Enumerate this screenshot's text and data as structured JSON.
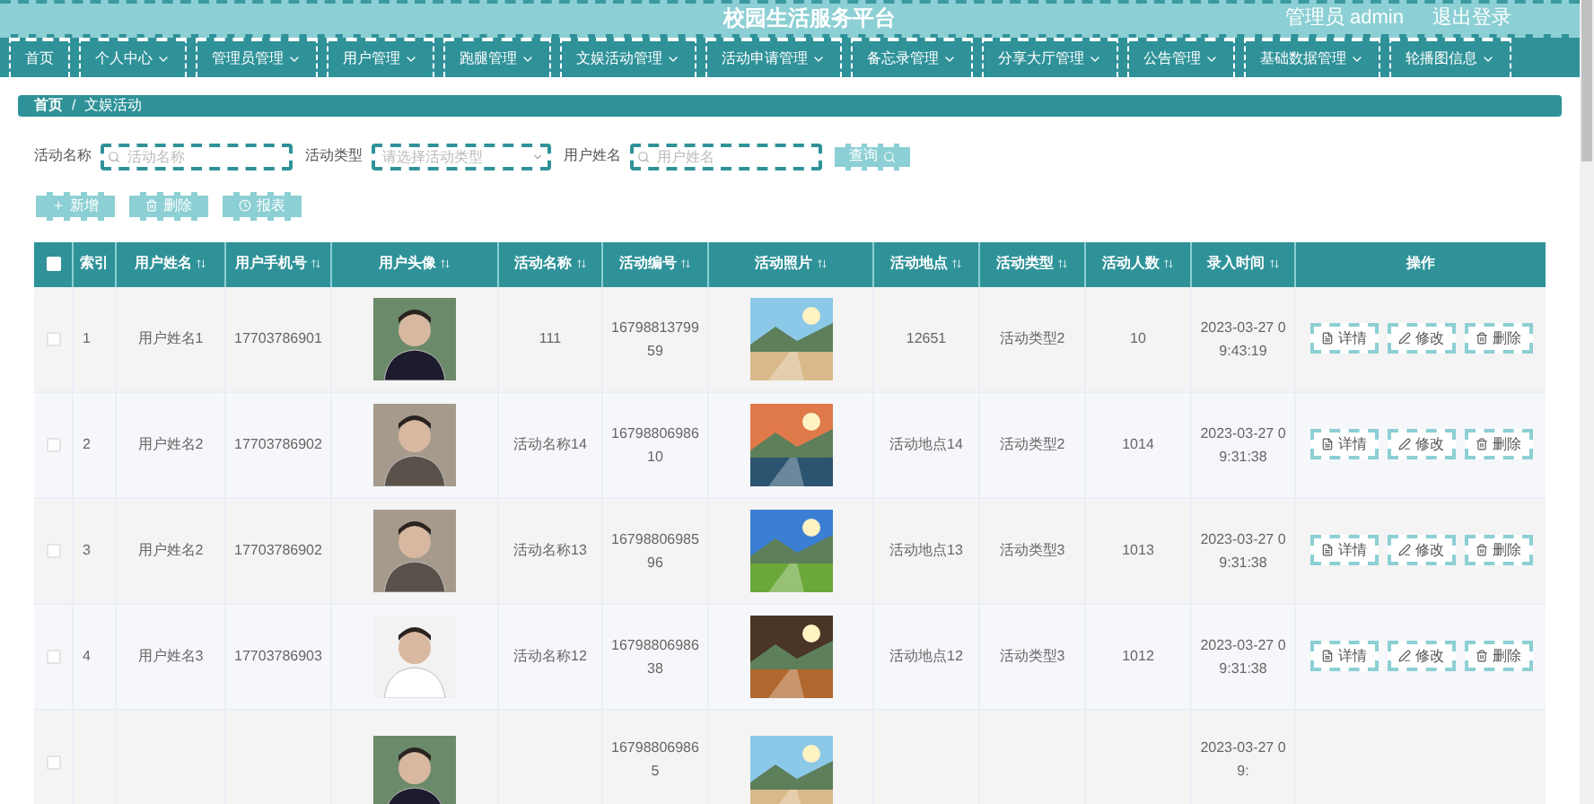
{
  "header": {
    "title": "校园生活服务平台",
    "user": "管理员 admin",
    "logout": "退出登录"
  },
  "nav": [
    {
      "label": "首页",
      "dropdown": false
    },
    {
      "label": "个人中心",
      "dropdown": true
    },
    {
      "label": "管理员管理",
      "dropdown": true
    },
    {
      "label": "用户管理",
      "dropdown": true
    },
    {
      "label": "跑腿管理",
      "dropdown": true
    },
    {
      "label": "文娱活动管理",
      "dropdown": true
    },
    {
      "label": "活动申请管理",
      "dropdown": true
    },
    {
      "label": "备忘录管理",
      "dropdown": true
    },
    {
      "label": "分享大厅管理",
      "dropdown": true
    },
    {
      "label": "公告管理",
      "dropdown": true
    },
    {
      "label": "基础数据管理",
      "dropdown": true
    },
    {
      "label": "轮播图信息",
      "dropdown": true
    }
  ],
  "breadcrumb": [
    "首页",
    "/",
    "文娱活动"
  ],
  "filters": [
    {
      "kind": "search",
      "label": "活动名称",
      "placeholder": "活动名称"
    },
    {
      "kind": "select",
      "label": "活动类型",
      "placeholder": "请选择活动类型"
    },
    {
      "kind": "search",
      "label": "用户姓名",
      "placeholder": "用户姓名"
    }
  ],
  "query_button": "查询",
  "actions": [
    {
      "kind": "add",
      "label": "新增"
    },
    {
      "kind": "delete",
      "label": "删除"
    },
    {
      "kind": "report",
      "label": "报表"
    }
  ],
  "table": {
    "select_all": false,
    "columns": [
      {
        "label": "索引",
        "sortable": false
      },
      {
        "label": "用户姓名",
        "sortable": true
      },
      {
        "label": "用户手机号",
        "sortable": true
      },
      {
        "label": "用户头像",
        "sortable": true
      },
      {
        "label": "活动名称",
        "sortable": true
      },
      {
        "label": "活动编号",
        "sortable": true
      },
      {
        "label": "活动照片",
        "sortable": true
      },
      {
        "label": "活动地点",
        "sortable": true
      },
      {
        "label": "活动类型",
        "sortable": true
      },
      {
        "label": "活动人数",
        "sortable": true
      },
      {
        "label": "录入时间",
        "sortable": true
      },
      {
        "label": "操作",
        "sortable": false
      }
    ],
    "rows": [
      {
        "checked": false,
        "index": "1",
        "name": "用户姓名1",
        "phone": "17703786901",
        "activity": "111",
        "number": "1679881379959",
        "place": "12651",
        "type": "活动类型2",
        "count": "10",
        "time": "2023-03-27 09:43:19",
        "buttons": [
          {
            "kind": "detail",
            "label": "详情"
          },
          {
            "kind": "edit",
            "label": "修改"
          },
          {
            "kind": "delete",
            "label": "删除"
          }
        ]
      },
      {
        "checked": false,
        "index": "2",
        "name": "用户姓名2",
        "phone": "17703786902",
        "activity": "活动名称14",
        "number": "1679880698610",
        "place": "活动地点14",
        "type": "活动类型2",
        "count": "1014",
        "time": "2023-03-27 09:31:38",
        "buttons": [
          {
            "kind": "detail",
            "label": "详情"
          },
          {
            "kind": "edit",
            "label": "修改"
          },
          {
            "kind": "delete",
            "label": "删除"
          }
        ]
      },
      {
        "checked": false,
        "index": "3",
        "name": "用户姓名2",
        "phone": "17703786902",
        "activity": "活动名称13",
        "number": "1679880698596",
        "place": "活动地点13",
        "type": "活动类型3",
        "count": "1013",
        "time": "2023-03-27 09:31:38",
        "buttons": [
          {
            "kind": "detail",
            "label": "详情"
          },
          {
            "kind": "edit",
            "label": "修改"
          },
          {
            "kind": "delete",
            "label": "删除"
          }
        ]
      },
      {
        "checked": false,
        "index": "4",
        "name": "用户姓名3",
        "phone": "17703786903",
        "activity": "活动名称12",
        "number": "1679880698638",
        "place": "活动地点12",
        "type": "活动类型3",
        "count": "1012",
        "time": "2023-03-27 09:31:38",
        "buttons": [
          {
            "kind": "detail",
            "label": "详情"
          },
          {
            "kind": "edit",
            "label": "修改"
          },
          {
            "kind": "delete",
            "label": "删除"
          }
        ]
      },
      {
        "checked": false,
        "number": "167988069865",
        "time": "2023-03-27 09:"
      }
    ]
  }
}
